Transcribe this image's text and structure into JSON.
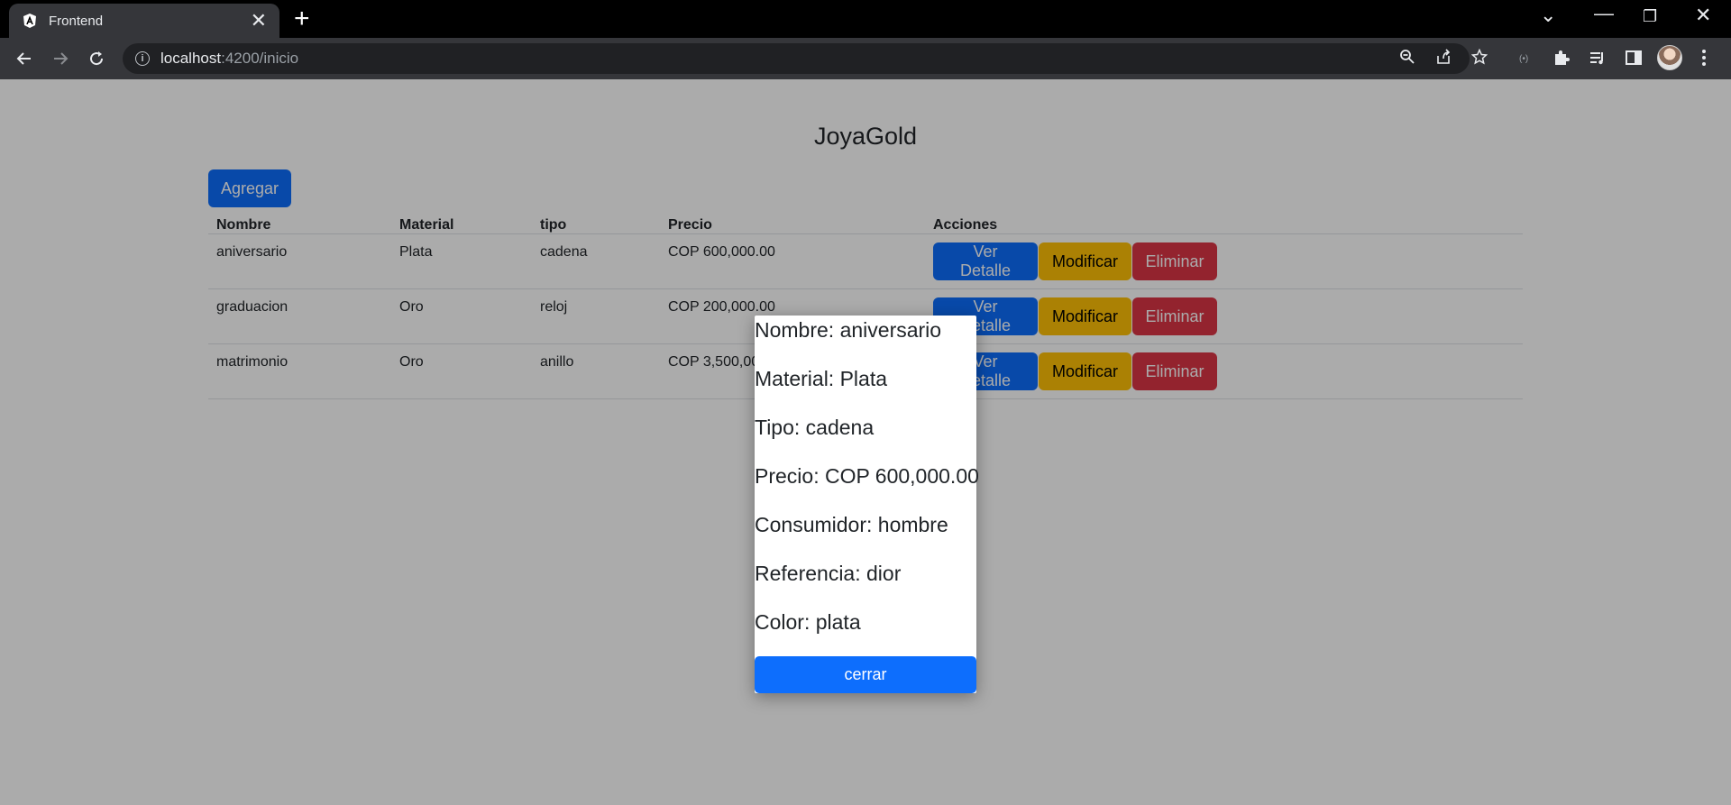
{
  "browser": {
    "tab_title": "Frontend",
    "url_host": "localhost",
    "url_path": ":4200/inicio"
  },
  "app": {
    "title": "JoyaGold",
    "add_label": "Agregar"
  },
  "table": {
    "headers": [
      "Nombre",
      "Material",
      "tipo",
      "Precio",
      "Acciones"
    ],
    "rows": [
      {
        "nombre": "aniversario",
        "material": "Plata",
        "tipo": "cadena",
        "precio": "COP 600,000.00"
      },
      {
        "nombre": "graduacion",
        "material": "Oro",
        "tipo": "reloj",
        "precio": "COP 200,000.00"
      },
      {
        "nombre": "matrimonio",
        "material": "Oro",
        "tipo": "anillo",
        "precio": "COP 3,500,000.00"
      }
    ],
    "actions": {
      "view": "Ver Detalle",
      "edit": "Modificar",
      "delete": "Eliminar"
    }
  },
  "modal": {
    "lines": [
      "Nombre: aniversario",
      "Material: Plata",
      "Tipo: cadena",
      "Precio: COP 600,000.00",
      "Consumidor: hombre",
      "Referencia: dior",
      "Color: plata"
    ],
    "close_label": "cerrar"
  },
  "colors": {
    "primary": "#0d6efd",
    "warning": "#ffc107",
    "danger": "#dc3545",
    "backdrop": "rgba(0,0,0,0.33)"
  }
}
